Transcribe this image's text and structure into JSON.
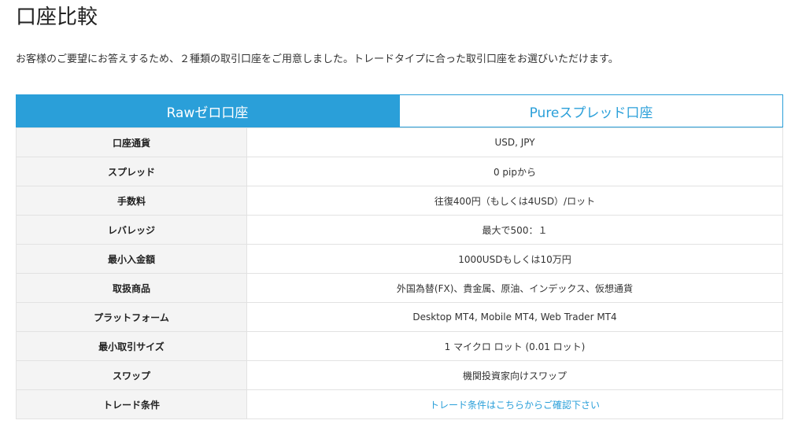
{
  "page": {
    "title": "口座比較",
    "intro": "お客様のご要望にお答えするため、２種類の取引口座をご用意しました。トレードタイプに合った取引口座をお選びいただけます。"
  },
  "tabs": [
    {
      "label": "Rawゼロ口座",
      "active": true
    },
    {
      "label": "Pureスプレッド口座",
      "active": false
    }
  ],
  "table": {
    "rows": [
      {
        "label": "口座通貨",
        "value": "USD, JPY"
      },
      {
        "label": "スプレッド",
        "value": "0 pipから"
      },
      {
        "label": "手数料",
        "value": "往復400円（もしくは4USD）/ロット"
      },
      {
        "label": "レバレッジ",
        "value": "最大で500：１"
      },
      {
        "label": "最小入金額",
        "value": "1000USDもしくは10万円"
      },
      {
        "label": "取扱商品",
        "value": "外国為替(FX)、貴金属、原油、インデックス、仮想通貨"
      },
      {
        "label": "プラットフォーム",
        "value": "Desktop MT4, Mobile MT4, Web Trader MT4"
      },
      {
        "label": "最小取引サイズ",
        "value": "1 マイクロ ロット (0.01 ロット)"
      },
      {
        "label": "スワップ",
        "value": "機関投資家向けスワップ"
      },
      {
        "label": "トレード条件",
        "value": "トレード条件はこちらからご確認下さい"
      }
    ]
  },
  "colors": {
    "accent": "#2a9fd9",
    "label_bg": "#f4f4f4",
    "border": "#e2e2e2"
  }
}
